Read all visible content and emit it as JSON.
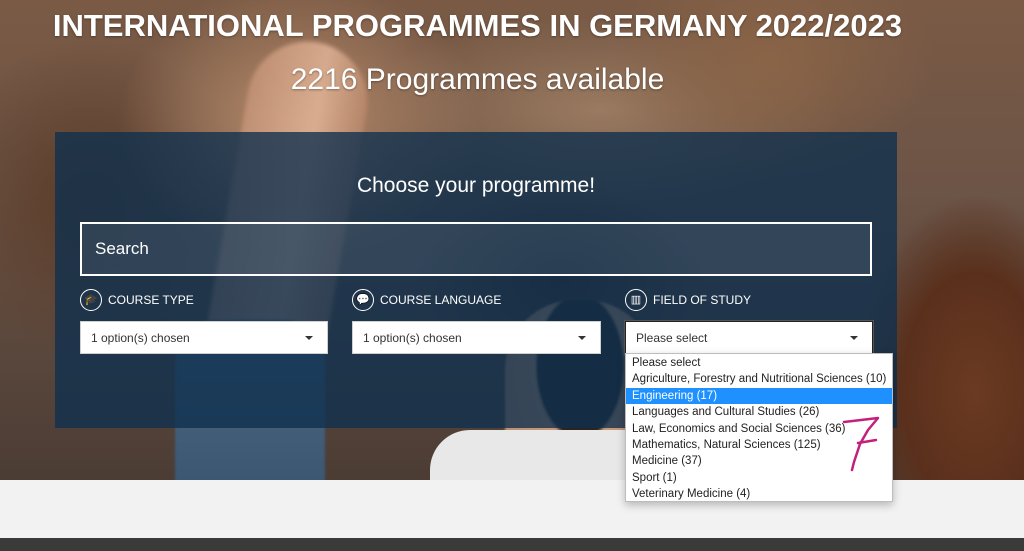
{
  "header": {
    "title": "INTERNATIONAL PROGRAMMES IN GERMANY 2022/2023",
    "subtitle": "2216 Programmes available"
  },
  "search_panel": {
    "heading": "Choose your programme!",
    "search_placeholder": "Search",
    "filters": [
      {
        "label": "COURSE TYPE",
        "icon": "graduation-cap-icon",
        "value": "1 option(s) chosen"
      },
      {
        "label": "COURSE LANGUAGE",
        "icon": "speech-bubble-icon",
        "value": "1 option(s) chosen"
      },
      {
        "label": "FIELD OF STUDY",
        "icon": "books-icon",
        "value": "Please select"
      }
    ]
  },
  "field_of_study_dropdown": {
    "options": [
      "Please select",
      "Agriculture, Forestry and Nutritional Sciences (10)",
      "Engineering (17)",
      "Languages and Cultural Studies (26)",
      "Law, Economics and Social Sciences (36)",
      "Mathematics, Natural Sciences (125)",
      "Medicine (37)",
      "Sport (1)",
      "Veterinary Medicine (4)"
    ],
    "highlighted_index": 2
  },
  "colors": {
    "panel": "#0e304e",
    "highlight": "#1e90ff",
    "annotation": "#c2207a"
  }
}
